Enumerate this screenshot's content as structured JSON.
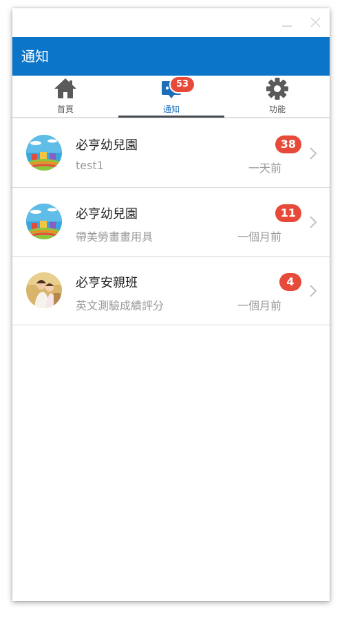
{
  "window": {
    "title": "通知"
  },
  "tabs": [
    {
      "label": "首頁",
      "icon": "home-icon"
    },
    {
      "label": "通知",
      "icon": "chat-icon",
      "badge": "53",
      "active": true
    },
    {
      "label": "功能",
      "icon": "gear-icon"
    }
  ],
  "notifications": [
    {
      "title": "必亨幼兒園",
      "subtitle": "test1",
      "time": "一天前",
      "count": "38",
      "avatar": "kindergarten-avatar"
    },
    {
      "title": "必亨幼兒園",
      "subtitle": "帶美勞畫畫用具",
      "time": "一個月前",
      "count": "11",
      "avatar": "kindergarten-avatar"
    },
    {
      "title": "必亨安親班",
      "subtitle": "英文測驗成績評分",
      "time": "一個月前",
      "count": "4",
      "avatar": "children-photo-avatar"
    }
  ],
  "colors": {
    "appbar": "#0b76c9",
    "badge": "#e84a3a",
    "active_tab": "#1b6fb8"
  }
}
